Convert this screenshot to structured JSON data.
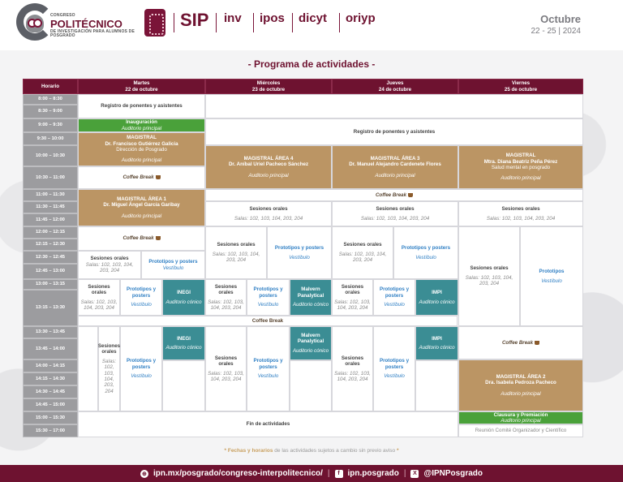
{
  "header": {
    "logo_small_top": "CONGRESO",
    "logo_big": "POLITÉCNICO",
    "logo_small_bottom": "DE INVESTIGACIÓN PARA ALUMNOS DE POSGRADO",
    "brands": [
      "SIP",
      "inv",
      "ipos",
      "dicyt",
      "oriyp"
    ],
    "month": "Octubre",
    "days": "22 - 25 | 2024"
  },
  "title": "- Programa de actividades -",
  "table": {
    "head": {
      "horario": "Horario",
      "day1": "Martes",
      "date1": "22 de octubre",
      "day2": "Miércoles",
      "date2": "23 de octubre",
      "day3": "Jueves",
      "date3": "24 de octubre",
      "day4": "Viernes",
      "date4": "25 de octubre"
    },
    "times": [
      "8:00 – 8:30",
      "8:30 – 9:00",
      "9:00 – 9:30",
      "9:30 – 10:00",
      "10:00 – 10:30",
      "10:30 – 11:00",
      "11:00 – 11:30",
      "11:30 – 11:45",
      "11:45 – 12:00",
      "12:00 – 12:15",
      "12:15 – 12:30",
      "12:30 – 12:45",
      "12:45 – 13:00",
      "13:00 – 13:15",
      "13:15 – 13:30",
      "13:30 – 13:45",
      "13:45 – 14:00",
      "14:00 – 14:15",
      "14:15 – 14:30",
      "14:30 – 14:45",
      "14:45 – 15:00",
      "15:00 – 15:30",
      "15:30 – 17:00"
    ],
    "registro": "Registro de ponentes y asistentes",
    "inauguracion": "Inauguración",
    "auditorio_principal": "Auditorio principal",
    "magistral": "MAGISTRAL",
    "mag_tue_name": "Dr. Francisco Gutiérrez Galicia",
    "mag_tue_sub": "Dirección de Posgrado",
    "mag4_title": "MAGISTRAL ÁREA 4",
    "mag4_name": "Dr. Aníbal Uriel Pacheco Sánchez",
    "mag3_title": "MAGISTRAL ÁREA 3",
    "mag3_name": "Dr. Manuel Alejandro Cardenete Flores",
    "mag_fri_name": "Mtra. Diana Beatriz Peña Pérez",
    "mag_fri_sub": "Salud mental en posgrado",
    "coffee": "Coffee Break",
    "mag1_title": "MAGISTRAL ÁREA 1",
    "mag1_name": "Dr. Miguel Ángel García Garibay",
    "sesiones": "Sesiones orales",
    "salas": "Salas: 102, 103, 104, 203, 204",
    "salas_tue": "Salas: 102, 103, 104, 203, 204",
    "prototipos": "Prototipos y posters",
    "prototipos_fri": "Prototipos",
    "vestibulo": "Vestíbulo",
    "inegi": "INEGI",
    "auditorio_conico": "Auditorio cónico",
    "malvern": "Malvern Panalytical",
    "impi": "IMPI",
    "mag2_title": "MAGISTRAL ÁREA 2",
    "mag2_name": "Dra. Isabela Pedroza Pacheco",
    "fin": "Fin de actividades",
    "clausura": "Clausura y Premiación",
    "reunion": "Reunión Comité Organizador y Científico"
  },
  "note": {
    "prefix": "*",
    "bold": "Fechas y horarios",
    "rest": "de las actividades sujetos a cambio sin previo aviso",
    "suffix": "*"
  },
  "footer": {
    "url": "ipn.mx/posgrado/congreso-interpolitecnico/",
    "facebook": "ipn.posgrado",
    "x": "@IPNPosgrado",
    "sep": "|"
  },
  "colors": {
    "maroon": "#6e1230",
    "gold": "#bb9564",
    "green": "#4aa13a",
    "teal": "#3b8d94",
    "time_grey": "#9c9c9f"
  }
}
